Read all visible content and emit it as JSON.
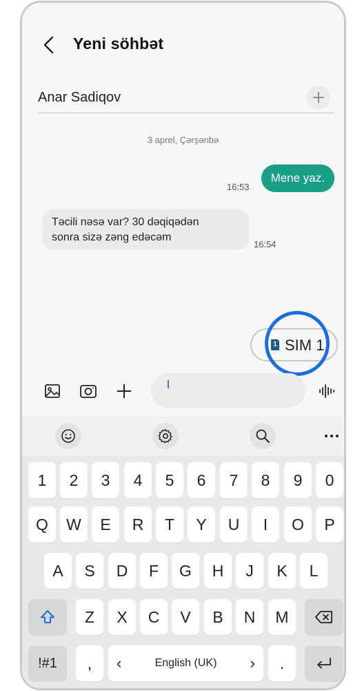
{
  "header": {
    "title": "Yeni söhbət"
  },
  "recipient": {
    "name": "Anar Sadiqov"
  },
  "conversation": {
    "date": "3 aprel, Çərşənbə",
    "outgoing": {
      "text": "Mene yaz.",
      "time": "16:53"
    },
    "incoming": {
      "line1": "Təcili nəsə var? 30 dəqiqədən",
      "line2": "sonra sizə zəng edəcəm",
      "time": "16:54"
    }
  },
  "sim": {
    "number": "1",
    "label": "SIM 1"
  },
  "keyboard": {
    "row1": [
      "1",
      "2",
      "3",
      "4",
      "5",
      "6",
      "7",
      "8",
      "9",
      "0"
    ],
    "row2": [
      "Q",
      "W",
      "E",
      "R",
      "T",
      "Y",
      "U",
      "I",
      "O",
      "P"
    ],
    "row3": [
      "A",
      "S",
      "D",
      "F",
      "G",
      "H",
      "J",
      "K",
      "L"
    ],
    "row4": [
      "Z",
      "X",
      "C",
      "V",
      "B",
      "N",
      "M"
    ],
    "symbols_label": "!#1",
    "comma": ",",
    "language": "English (UK)",
    "period": ".",
    "lang_prev": "‹",
    "lang_next": "›"
  },
  "colors": {
    "accent": "#17a085",
    "highlight": "#1d6de0",
    "sim_icon": "#1f5b86",
    "shift": "#1d6de0"
  }
}
